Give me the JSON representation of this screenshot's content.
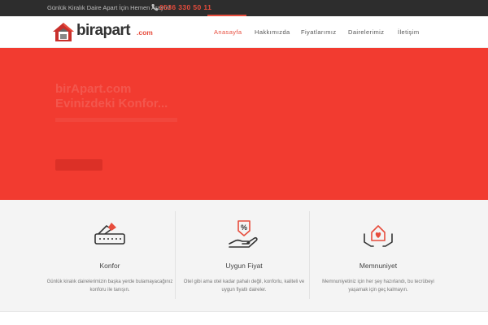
{
  "topbar": {
    "message": "Günlük Kiralık Daire Apart İçin Hemen Arayın!",
    "phone_icon": "phone-icon",
    "phone": "0536 330 50 11"
  },
  "logo": {
    "brand": "birapart",
    "suffix": ".com",
    "icon": "house-logo-icon"
  },
  "nav": {
    "items": [
      {
        "label": "Anasayfa",
        "active": true
      },
      {
        "label": "Hakkımızda",
        "active": false
      },
      {
        "label": "Fiyatlarımız",
        "active": false
      },
      {
        "label": "Dairelerimiz",
        "active": false
      },
      {
        "label": "İletişim",
        "active": false
      }
    ]
  },
  "hero": {
    "background": "#f23b30",
    "title_line1": "birApart.com",
    "title_line2": "Evinizdeki Konfor..."
  },
  "features": [
    {
      "icon": "comfort-mattress-icon",
      "title": "Konfor",
      "description": "Günlük kiralık dairelerimizin başka yerde bulamayacağınız konforu ile tanışın."
    },
    {
      "icon": "discount-price-hand-icon",
      "title": "Uygun Fiyat",
      "description": "Otel gibi ama otel kadar pahalı değil, konforlu, kaliteli ve uygun fiyatlı daireler."
    },
    {
      "icon": "satisfaction-home-heart-icon",
      "title": "Memnuniyet",
      "description": "Memnuniyetiniz için her şey hazırlandı, bu tecrübeyi yaşamak için geç kalmayın."
    }
  ],
  "colors": {
    "accent": "#e74c3c",
    "topbar": "#2d2d2d",
    "features_bg": "#f4f4f4"
  }
}
